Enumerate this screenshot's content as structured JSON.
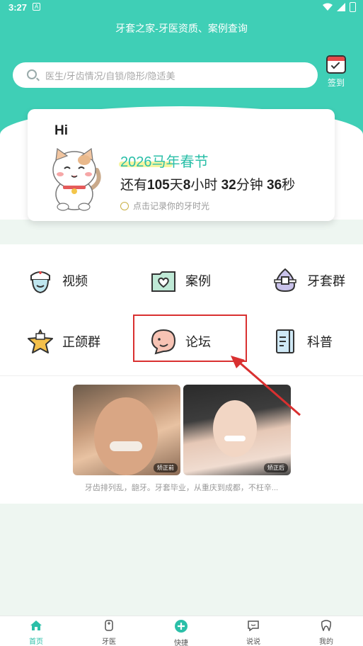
{
  "status": {
    "time": "3:27",
    "notif": "A"
  },
  "app": {
    "title": "牙套之家-牙医资质、案例查询"
  },
  "search": {
    "placeholder": "医生/牙齿情况/自锁/隐形/隐适美"
  },
  "checkin": {
    "label": "签到"
  },
  "card": {
    "greeting": "Hi",
    "event_title": "2026马年春节",
    "countdown_prefix": "还有",
    "days": "105",
    "days_unit": "天",
    "hours": "8",
    "hours_unit": "小时 ",
    "minutes": "32",
    "minutes_unit": "分钟 ",
    "seconds": "36",
    "seconds_unit": "秒",
    "record_text": "点击记录你的牙时光"
  },
  "menu": {
    "items": [
      {
        "label": "视频",
        "icon": "nurse-icon"
      },
      {
        "label": "案例",
        "icon": "folder-heart-icon"
      },
      {
        "label": "牙套群",
        "icon": "braces-icon"
      },
      {
        "label": "正颌群",
        "icon": "star-icon"
      },
      {
        "label": "论坛",
        "icon": "chat-bubble-icon"
      },
      {
        "label": "科普",
        "icon": "notebook-icon"
      }
    ]
  },
  "case": {
    "before_tag": "矫正前",
    "after_tag": "矫正后",
    "caption": "牙齿排列乱，龅牙。牙套毕业，从重庆到成都，不枉辛..."
  },
  "tabs": [
    {
      "label": "首页",
      "icon": "home-icon"
    },
    {
      "label": "牙医",
      "icon": "doctor-icon"
    },
    {
      "label": "快捷",
      "icon": "plus-circle-icon"
    },
    {
      "label": "说说",
      "icon": "message-icon"
    },
    {
      "label": "我的",
      "icon": "tooth-icon"
    }
  ],
  "colors": {
    "brand": "#3fcfb6",
    "accent": "#2bbfa8",
    "highlight": "#d93030"
  }
}
